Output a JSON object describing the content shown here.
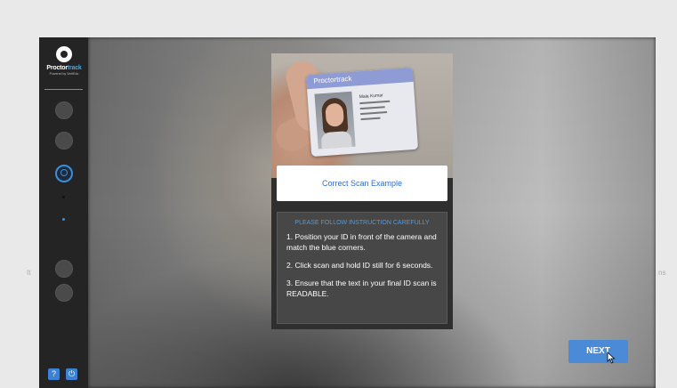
{
  "sidebar": {
    "logo_text": "Proctor",
    "logo_text_accent": "track",
    "logo_sub": "Powered by VerifEdu",
    "nav_icons": [
      "edit-icon",
      "camera-icon",
      "user-id-icon",
      "dot-icon",
      "blue-dot-icon",
      "chat-icon",
      "info-icon"
    ],
    "bottom_buttons": [
      "help-icon",
      "power-icon"
    ]
  },
  "card": {
    "id_brand": "Proctortrack",
    "id_name": "Mala Kumar",
    "scan_example_label": "Correct Scan Example",
    "instructions_heading": "PLEASE FOLLOW INSTRUCTION CAREFULLY",
    "instructions": [
      "1. Position your ID in front of the camera and match the blue corners.",
      "2. Click scan and hold ID still for 6 seconds.",
      "3. Ensure that the text in your final ID scan is READABLE."
    ]
  },
  "next_label": "NEXT",
  "colors": {
    "accent": "#3b8ed8",
    "next_button": "#4a8ad6",
    "sidebar": "#242424"
  }
}
